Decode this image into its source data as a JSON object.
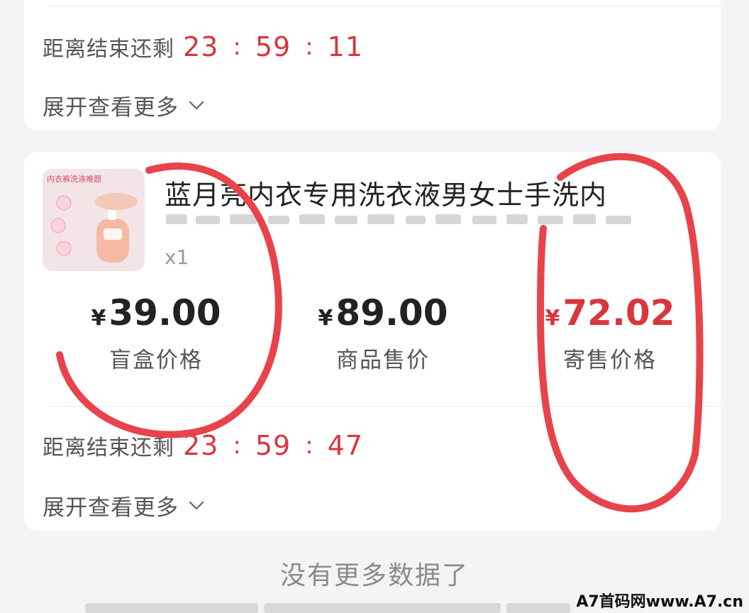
{
  "card1": {
    "countdown": {
      "label": "距离结束还剩",
      "hours": "23",
      "minutes": "59",
      "seconds": "11"
    },
    "expand_label": "展开查看更多"
  },
  "card2": {
    "product_title": "蓝月亮内衣专用洗衣液男女士手洗内",
    "quantity": "x1",
    "thumbnail_text": "内衣裤洗涤难题",
    "prices": [
      {
        "symbol": "¥",
        "value": "39.00",
        "label": "盲盒价格"
      },
      {
        "symbol": "¥",
        "value": "89.00",
        "label": "商品售价"
      },
      {
        "symbol": "¥",
        "value": "72.02",
        "label": "寄售价格"
      }
    ],
    "countdown": {
      "label": "距离结束还剩",
      "hours": "23",
      "minutes": "59",
      "seconds": "47"
    },
    "expand_label": "展开查看更多"
  },
  "footer": {
    "no_more_text": "没有更多数据了"
  },
  "watermark": "A7首码网www.A7.cn",
  "colors": {
    "accent_red": "#d9363e",
    "annotation_red": "#e8434b"
  }
}
